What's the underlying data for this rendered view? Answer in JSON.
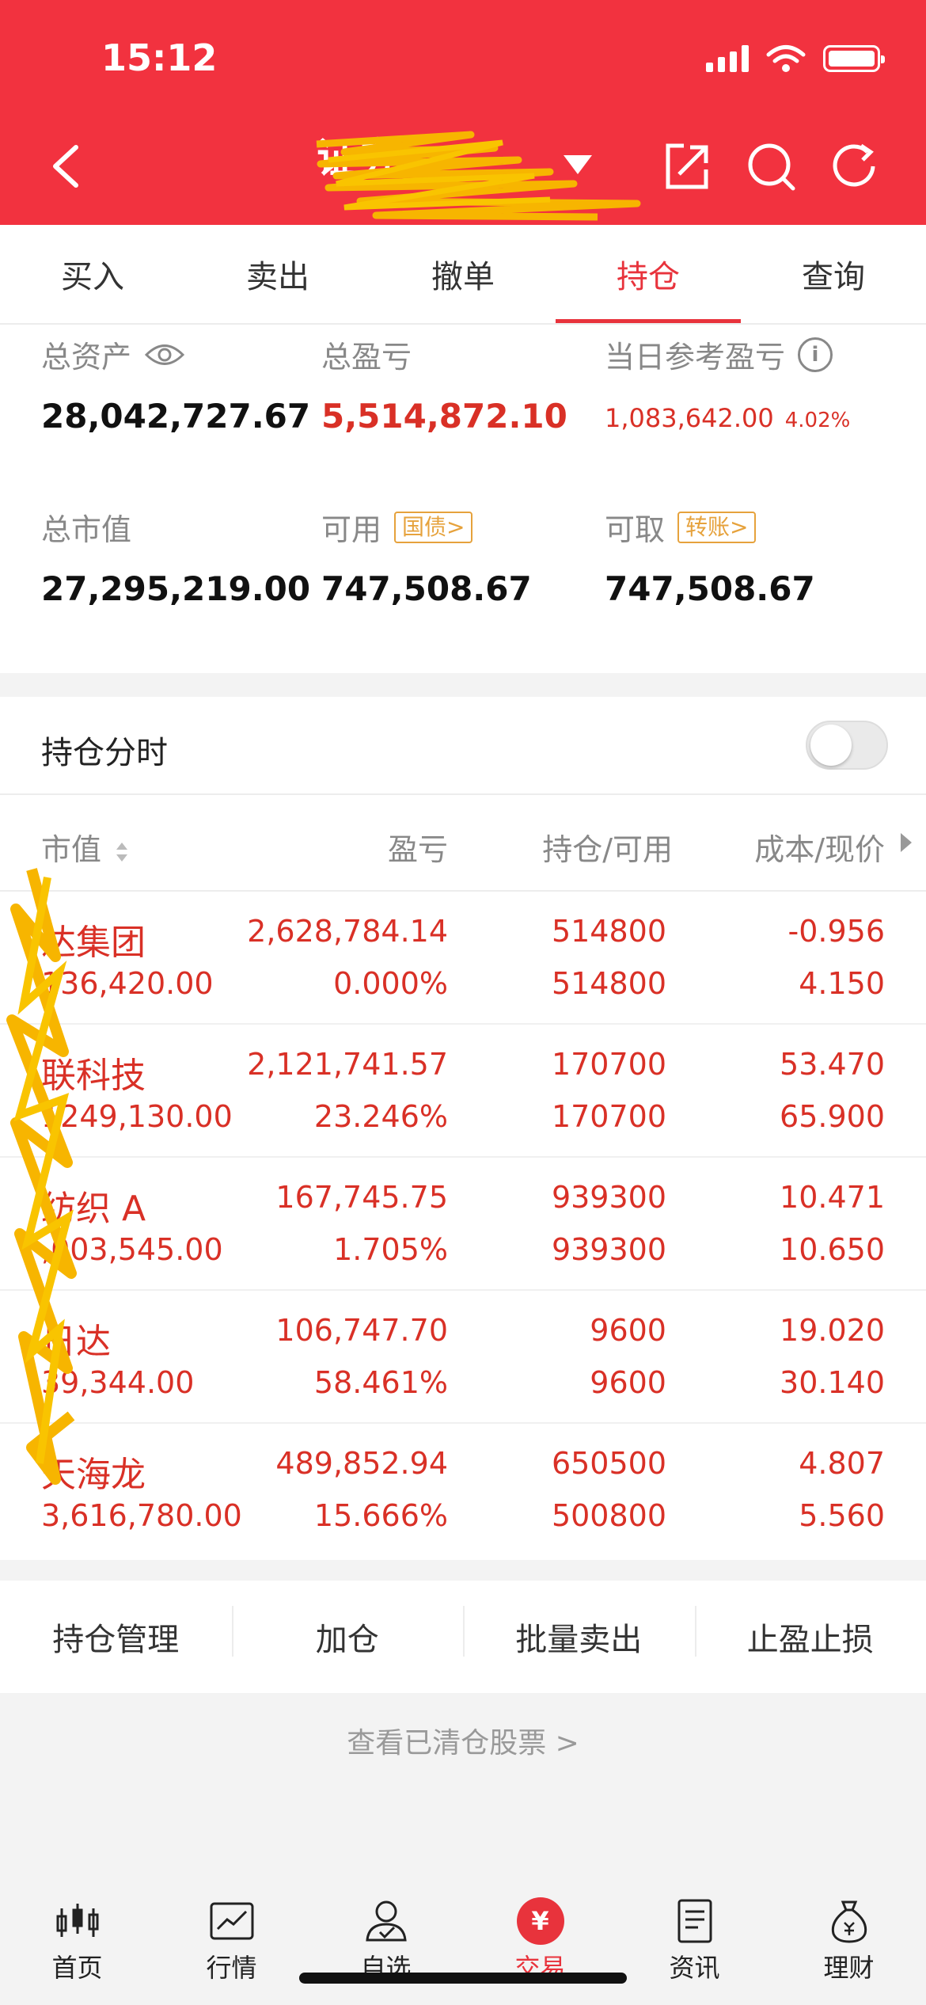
{
  "status": {
    "time": "15:12"
  },
  "nav": {
    "title": "证券"
  },
  "tabs": [
    "买入",
    "卖出",
    "撤单",
    "持仓",
    "查询"
  ],
  "summary": {
    "total_assets_label": "总资产",
    "total_assets": "28,042,727.67",
    "total_pnl_label": "总盈亏",
    "total_pnl": "5,514,872.10",
    "daily_pnl_label": "当日参考盈亏",
    "daily_pnl": "1,083,642.00",
    "daily_pnl_pct": "4.02%",
    "market_value_label": "总市值",
    "market_value": "27,295,219.00",
    "available_label": "可用",
    "available_badge": "国债>",
    "available": "747,508.67",
    "withdrawable_label": "可取",
    "withdrawable_badge": "转账>",
    "withdrawable": "747,508.67"
  },
  "timeline": {
    "label": "持仓分时",
    "enabled": false
  },
  "table": {
    "headers": {
      "market_value": "市值",
      "pnl": "盈亏",
      "position": "持仓/可用",
      "cost": "成本/现价"
    },
    "rows": [
      {
        "name": "达集团",
        "value": "136,420.00",
        "pnl": "2,628,784.14",
        "pnl_pct": "0.000%",
        "hold": "514800",
        "avail": "514800",
        "cost": "-0.956",
        "price": "4.150"
      },
      {
        "name": "联科技",
        "value": "1249,130.00",
        "pnl": "2,121,741.57",
        "pnl_pct": "23.246%",
        "hold": "170700",
        "avail": "170700",
        "cost": "53.470",
        "price": "65.900"
      },
      {
        "name": "纺织 A",
        "value": ",003,545.00",
        "pnl": "167,745.75",
        "pnl_pct": "1.705%",
        "hold": "939300",
        "avail": "939300",
        "cost": "10.471",
        "price": "10.650"
      },
      {
        "name": "日达",
        "value": "39,344.00",
        "pnl": "106,747.70",
        "pnl_pct": "58.461%",
        "hold": "9600",
        "avail": "9600",
        "cost": "19.020",
        "price": "30.140"
      },
      {
        "name": "天海龙",
        "value": "3,616,780.00",
        "pnl": "489,852.94",
        "pnl_pct": "15.666%",
        "hold": "650500",
        "avail": "500800",
        "cost": "4.807",
        "price": "5.560"
      }
    ]
  },
  "actions": [
    "持仓管理",
    "加仓",
    "批量卖出",
    "止盈止损"
  ],
  "cleared_link": "查看已清仓股票 >",
  "bottom_nav": [
    "首页",
    "行情",
    "自选",
    "交易",
    "资讯",
    "理财"
  ],
  "bottom_nav_trade_badge": "¥",
  "colors": {
    "header": "#f2323f",
    "accent": "#e8333c",
    "gain": "#d93026",
    "badge": "#e6a23c"
  }
}
